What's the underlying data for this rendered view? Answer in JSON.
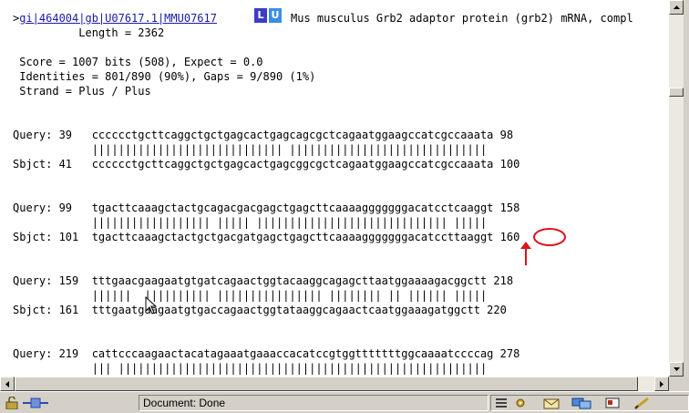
{
  "hit": {
    "prefix": ">",
    "id_link": "gi|464004|gb|U07617.1|MMU07617",
    "badge_l": "L",
    "badge_u": "U",
    "description": "Mus musculus Grb2 adaptor protein (grb2) mRNA, compl",
    "length_line": "          Length = 2362"
  },
  "stats": {
    "score": " Score = 1007 bits (508), Expect = 0.0",
    "identities": " Identities = 801/890 (90%), Gaps = 9/890 (1%)",
    "strand": " Strand = Plus / Plus"
  },
  "alignments": [
    {
      "query": "Query: 39   cccccctgcttcaggctgctgagcactgagcagcgctcagaatggaagccatcgccaaata 98",
      "match": "            ||||||||||||||||||||||||||||| ||||||||||||||||||||||||||||||",
      "sbjct": "Sbjct: 41   cccccctgcttcaggctgctgagcactgagcggcgctcagaatggaagccatcgccaaata 100"
    },
    {
      "query": "Query: 99   tgacttcaaagctactgcagacgacgagctgagcttcaaaagggggggacatcctcaaggt 158",
      "match": "            |||||||||||||||||| ||||| ||||||||||||||||||||||||||||| |||||",
      "sbjct": "Sbjct: 101  tgacttcaaagctactgctgacgatgagctgagcttcaaaagggggggacatccttaaggt 160"
    },
    {
      "query": "Query: 159  tttgaacgaagaatgtgatcagaactggtacaaggcagagcttaatggaaaagacggctt 218",
      "match": "            ||||||  |||||||||| |||||||||||||||| |||||||| || |||||| |||||",
      "sbjct": "Sbjct: 161  tttgaatgaagaatgtgaccagaactggtataaggcagaactcaatggaaagatggctt 220"
    },
    {
      "query": "Query: 219  cattcccaagaactacatagaaatgaaaccacatccgtggtttttttggcaaaatccccag 278",
      "match": "            ||| ||||||||||||||||||||||||||||||||||||||||||||||||||||||||"
    }
  ],
  "statusbar": {
    "text": "Document: Done"
  },
  "colors": {
    "link": "#1a1aa6",
    "badge_l": "#3c3cc8",
    "badge_u": "#3a8ee6",
    "annotation": "#d8141b"
  }
}
